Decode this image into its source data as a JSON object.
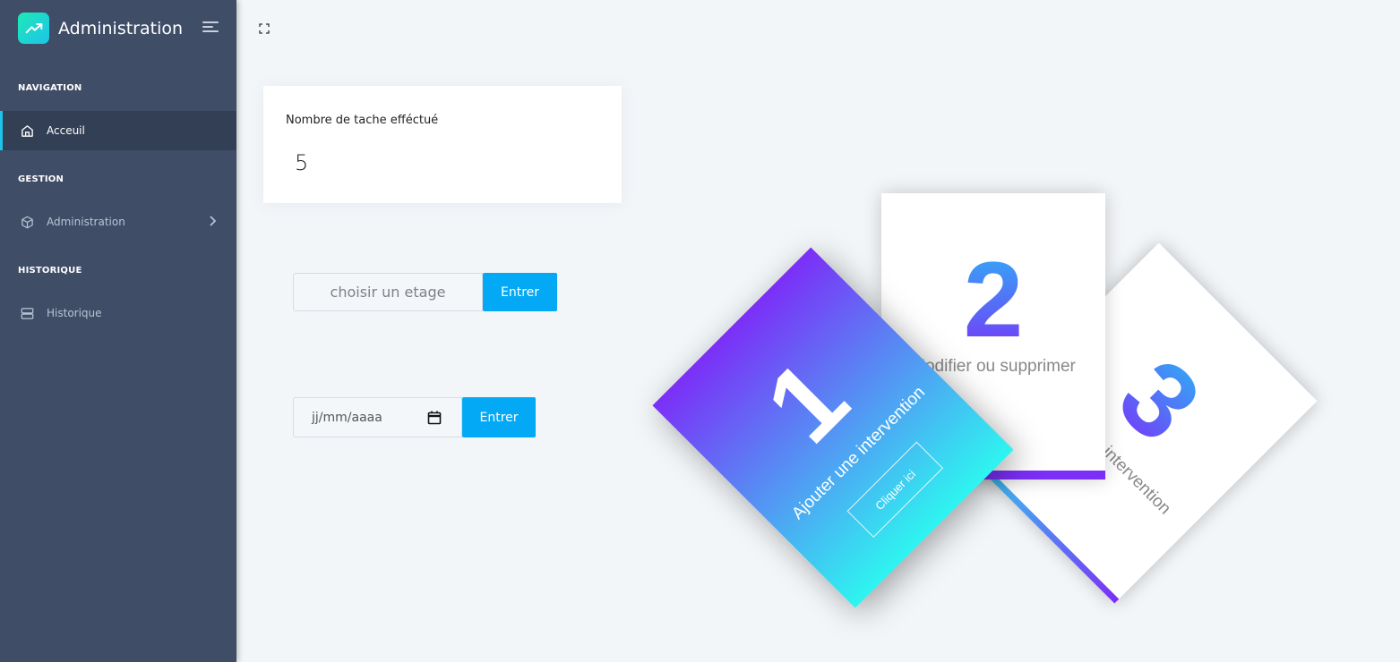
{
  "brand": {
    "title": "Administration",
    "logo_icon": "trending-up-icon"
  },
  "sidebar": {
    "captions": [
      "NAVIGATION",
      "GESTION",
      "HISTORIQUE"
    ],
    "items": [
      {
        "label": "Acceuil",
        "icon": "home-icon",
        "active": true
      },
      {
        "label": "Administration",
        "icon": "box-icon",
        "active": false
      },
      {
        "label": "Historique",
        "icon": "server-icon",
        "active": false
      }
    ]
  },
  "stat": {
    "label": "Nombre de tache efféctué",
    "value": "5"
  },
  "form_etage": {
    "placeholder": "choisir un etage",
    "button": "Entrer"
  },
  "form_date": {
    "value": "jj/mm/aaaa",
    "button": "Entrer"
  },
  "cards": {
    "card1": {
      "number": "1",
      "text": "Ajouter une intervention",
      "button": "Cliquer ici"
    },
    "card2": {
      "number": "2",
      "text": "Modifier ou supprimer"
    },
    "card3": {
      "number": "3",
      "text": "Historique intervention"
    }
  },
  "colors": {
    "sidebar": "#3f4d67",
    "accent": "#04a9f5",
    "brand": "#1dc4e9",
    "card_gradient_start": "#7b2ff7",
    "card_gradient_end": "#2ef5f0"
  }
}
